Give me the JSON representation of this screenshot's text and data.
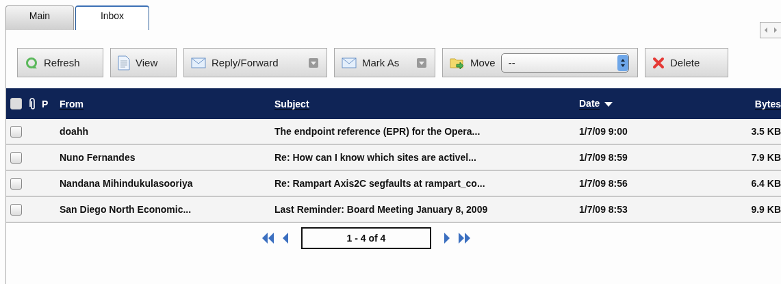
{
  "tabs": [
    {
      "label": "Main",
      "selected": false
    },
    {
      "label": "Inbox",
      "selected": true
    }
  ],
  "toolbar": [
    {
      "kind": "refresh",
      "label": "Refresh",
      "dropdown": false
    },
    {
      "kind": "view",
      "label": "View",
      "dropdown": false
    },
    {
      "kind": "mail",
      "label": "Reply/Forward",
      "dropdown": true
    },
    {
      "kind": "mail",
      "label": "Mark As",
      "dropdown": true
    },
    {
      "kind": "move",
      "label": "Move",
      "select_value": "--"
    },
    {
      "kind": "delete",
      "label": "Delete",
      "dropdown": false
    }
  ],
  "table": {
    "select_all": {
      "checked": false
    },
    "columns": {
      "priority": "P",
      "from": "From",
      "subject": "Subject",
      "date": "Date",
      "bytes": "Bytes"
    },
    "rows": [
      {
        "checked": false,
        "from": "doahh",
        "subject": "The endpoint reference (EPR) for the Opera...",
        "date": "1/7/09 9:00",
        "bytes": "3.5 KB"
      },
      {
        "checked": false,
        "from": "Nuno Fernandes",
        "subject": "Re: How can I know which sites are activel...",
        "date": "1/7/09 8:59",
        "bytes": "7.9 KB"
      },
      {
        "checked": false,
        "from": "Nandana Mihindukulasooriya",
        "subject": "Re: Rampart Axis2C segfaults at rampart_co...",
        "date": "1/7/09 8:56",
        "bytes": "6.4 KB"
      },
      {
        "checked": false,
        "from": "San Diego North Economic...",
        "subject": "Last Reminder: Board Meeting January 8, 2009",
        "date": "1/7/09 8:53",
        "bytes": "9.9 KB"
      }
    ]
  },
  "pager": {
    "range": "1 - 4 of 4"
  }
}
